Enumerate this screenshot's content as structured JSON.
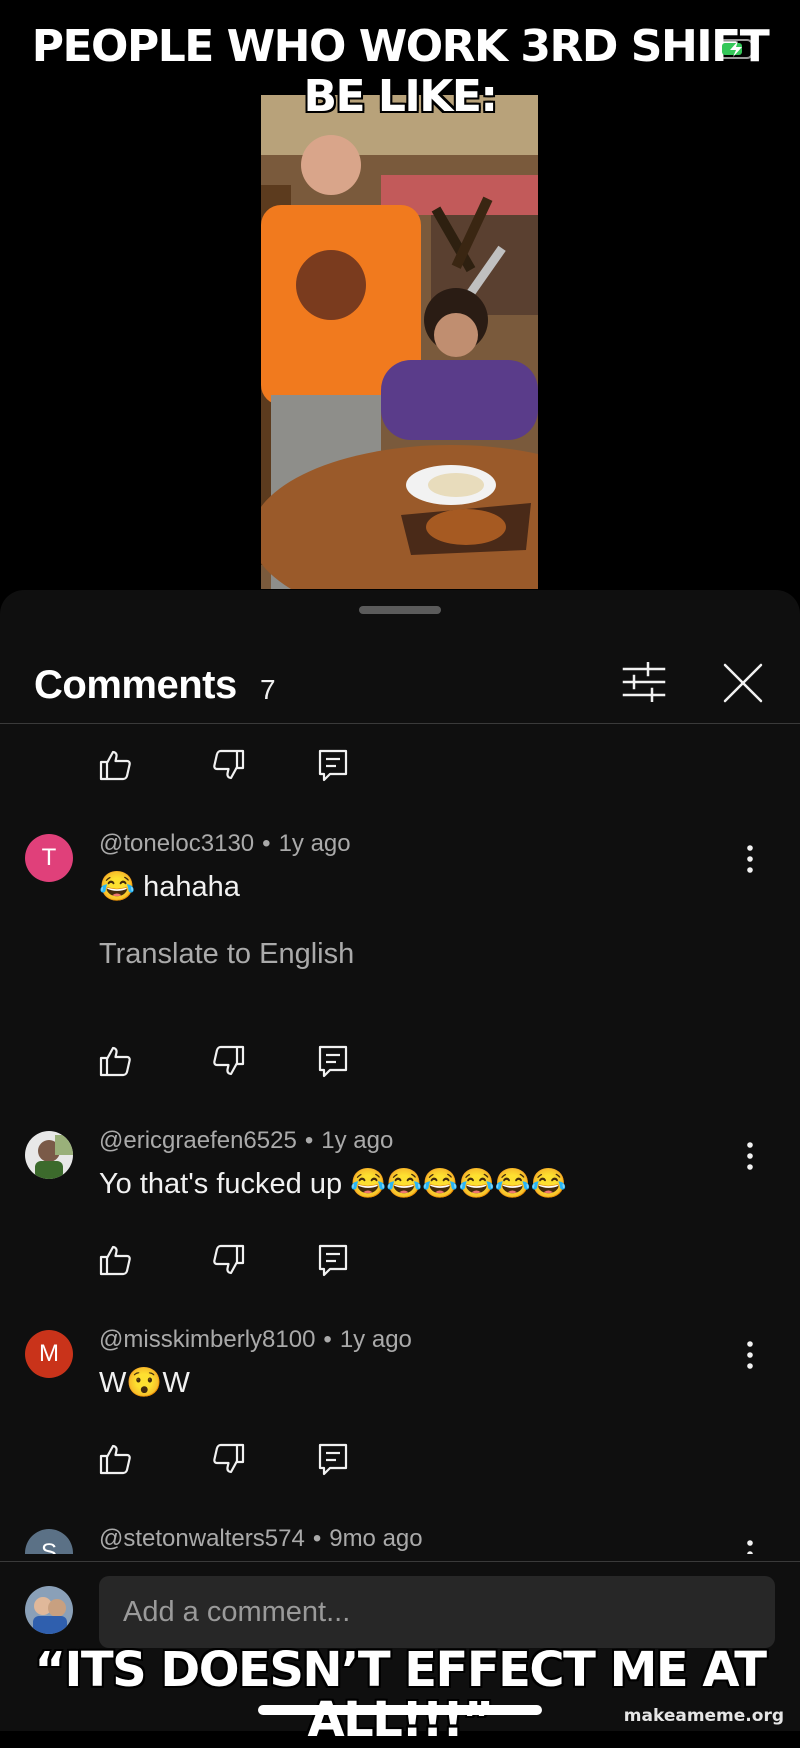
{
  "meme": {
    "top_caption": "PEOPLE WHO WORK 3RD SHIFT BE LIKE:",
    "bottom_caption": "“ITS DOESN’T EFFECT ME AT ALL!!!”",
    "watermark": "makeameme.org"
  },
  "comments_panel": {
    "title": "Comments",
    "count": "7",
    "comments": [
      {
        "avatar_letter": "T",
        "avatar_color": "#e0407a",
        "username": "@toneloc3130",
        "time": "1y ago",
        "text": "😂 hahaha",
        "translate": "Translate to English"
      },
      {
        "avatar_letter": "",
        "avatar_color": "#2f4a2a",
        "username": "@ericgraefen6525",
        "time": "1y ago",
        "text": "Yo that's fucked up 😂😂😂😂😂😂"
      },
      {
        "avatar_letter": "M",
        "avatar_color": "#c9331a",
        "username": "@misskimberly8100",
        "time": "1y ago",
        "text": "W😯W"
      },
      {
        "avatar_letter": "S",
        "avatar_color": "#5b7186",
        "username": "@stetonwalters574",
        "time": "9mo ago",
        "text": ""
      }
    ],
    "composer_placeholder": "Add a comment..."
  },
  "icons": {
    "like": "thumbs-up-icon",
    "dislike": "thumbs-down-icon",
    "reply": "reply-icon",
    "more": "more-vertical-icon",
    "filter": "filter-sliders-icon",
    "close": "close-icon"
  }
}
